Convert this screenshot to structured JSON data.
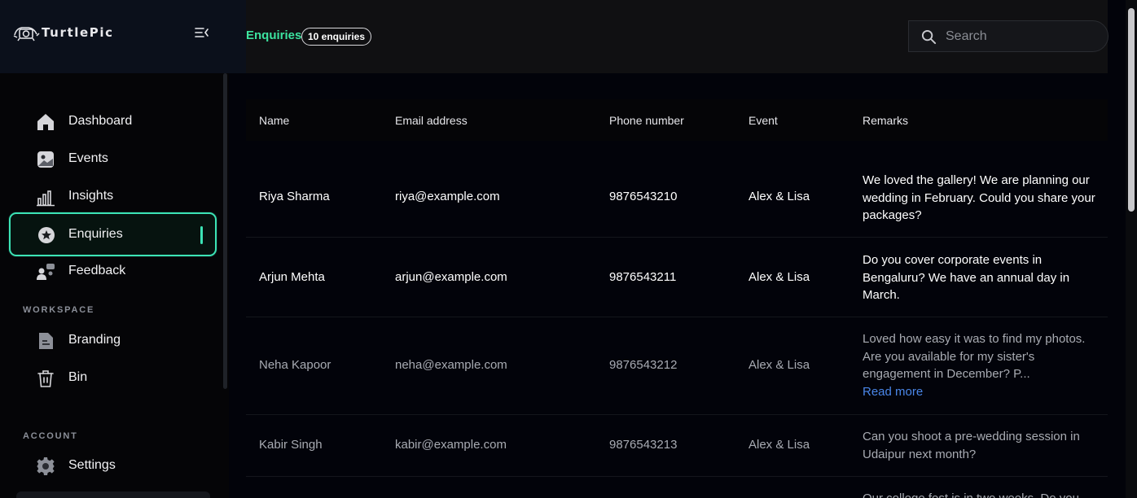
{
  "app": {
    "name": "TurtlePic"
  },
  "sidebar": {
    "items": [
      {
        "label": "Dashboard",
        "icon": "home-icon"
      },
      {
        "label": "Events",
        "icon": "image-icon"
      },
      {
        "label": "Insights",
        "icon": "bar-chart-icon"
      },
      {
        "label": "Enquiries",
        "icon": "star-badge-icon",
        "active": true
      },
      {
        "label": "Feedback",
        "icon": "people-icon"
      }
    ],
    "workspace_label": "WORKSPACE",
    "workspace_items": [
      {
        "label": "Branding",
        "icon": "document-icon"
      },
      {
        "label": "Bin",
        "icon": "trash-icon"
      }
    ],
    "account_label": "ACCOUNT",
    "account_items": [
      {
        "label": "Settings",
        "icon": "gear-icon"
      }
    ]
  },
  "header": {
    "title": "Enquiries",
    "count_badge": "10 enquiries",
    "search_placeholder": "Search"
  },
  "table": {
    "columns": [
      "Name",
      "Email address",
      "Phone number",
      "Event",
      "Remarks"
    ],
    "rows": [
      {
        "name": "Riya Sharma",
        "email": "riya@example.com",
        "phone": "9876543210",
        "event": "Alex & Lisa",
        "remarks": "We loved the gallery! We are planning our wedding in February. Could you share your packages?"
      },
      {
        "name": "Arjun Mehta",
        "email": "arjun@example.com",
        "phone": "9876543211",
        "event": "Alex & Lisa",
        "remarks": "Do you cover corporate events in Bengaluru? We have an annual day in March."
      },
      {
        "name": "Neha Kapoor",
        "email": "neha@example.com",
        "phone": "9876543212",
        "event": "Alex & Lisa",
        "remarks": "Loved how easy it was to find my photos. Are you available for my sister's engagement in December? P...",
        "read_more": "Read more"
      },
      {
        "name": "Kabir Singh",
        "email": "kabir@example.com",
        "phone": "9876543213",
        "event": "Alex & Lisa",
        "remarks": "Can you shoot a pre-wedding session in Udaipur next month?"
      },
      {
        "name": "",
        "email": "",
        "phone": "",
        "event": "",
        "remarks": "Our college fest is in two weeks. Do you"
      }
    ]
  },
  "colors": {
    "accent": "#3ce3b5",
    "title_green": "#3ce3a0",
    "link_blue": "#4a86e8",
    "background": "#02030a"
  }
}
